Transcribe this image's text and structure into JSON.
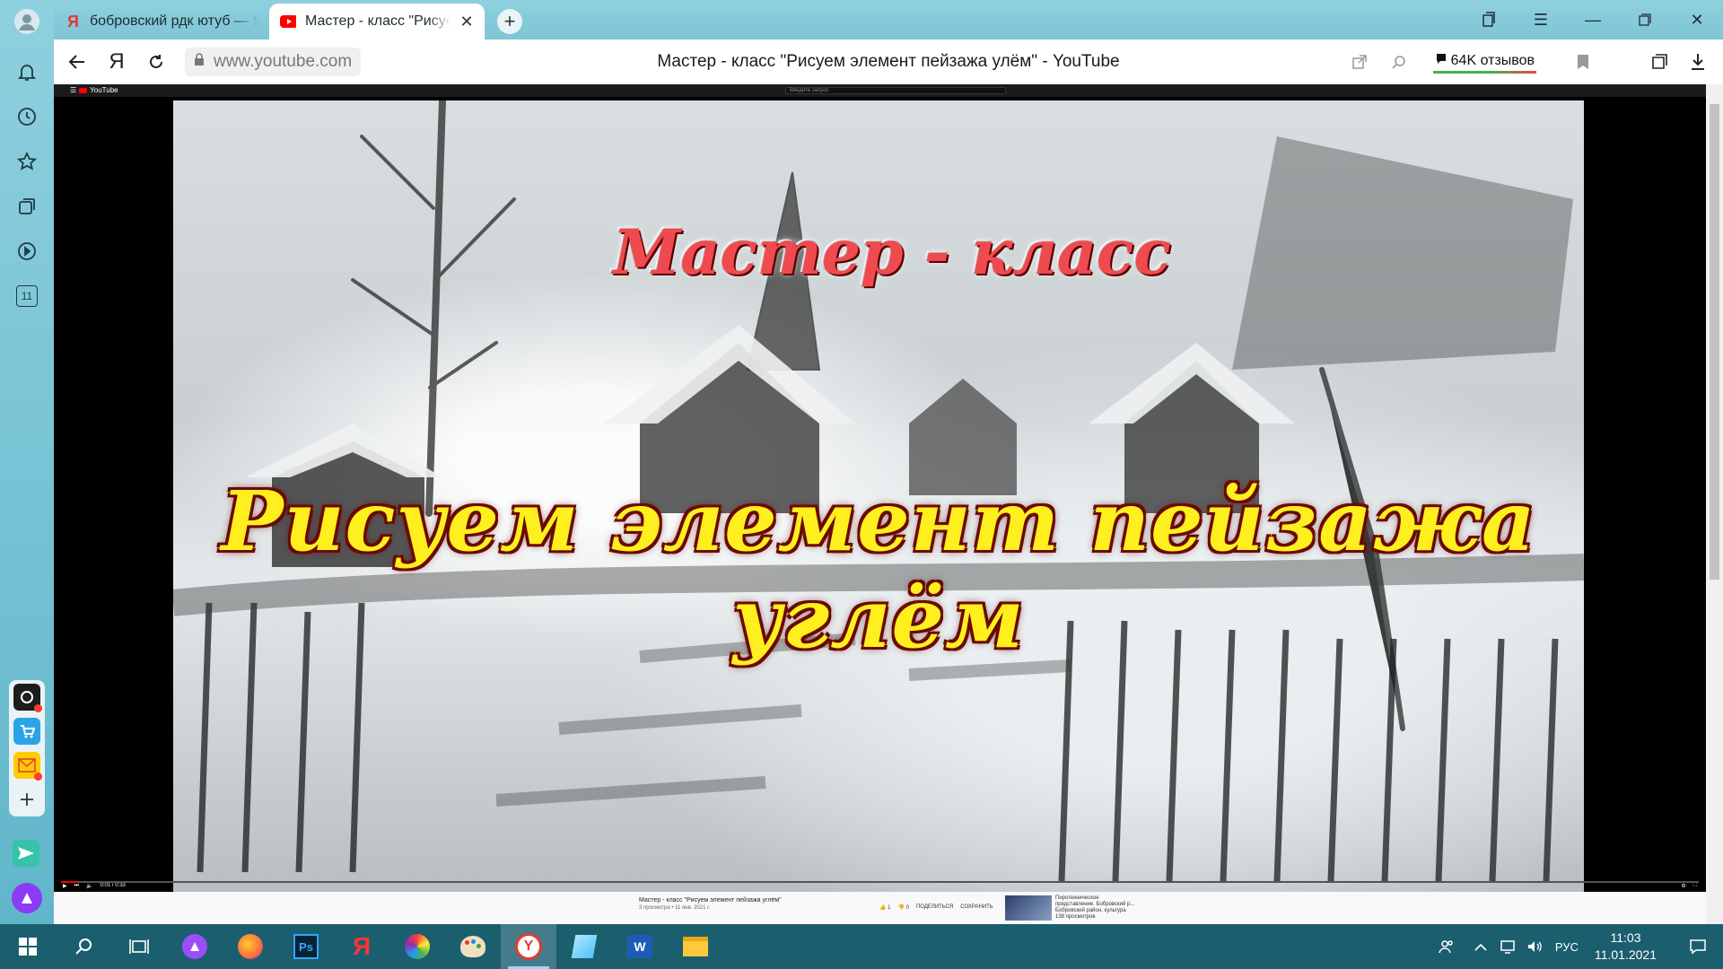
{
  "tabs": [
    {
      "title": "бобровский рдк ютуб — Я",
      "favicon": "yandex-icon"
    },
    {
      "title": "Мастер - класс \"Рисуем",
      "favicon": "youtube-icon",
      "active": true
    }
  ],
  "toolbar": {
    "yandex_button": "Я",
    "url": "www.youtube.com",
    "page_title": "Мастер - класс \"Рисуем элемент пейзажа улём\" - YouTube",
    "reviews": "64K отзывов"
  },
  "sidebar": {
    "tab_count": "11"
  },
  "youtube": {
    "logo": "YouTube",
    "search_placeholder": "Введите запрос",
    "video_title_line1": "Мастер - класс",
    "video_title_line2": "Рисуем элемент пейзажа углём",
    "progress": 0.01,
    "time": "0:01 / 0:33",
    "below_title": "Мастер - класс \"Рисуем элемент пейзажа углём\"",
    "below_meta": "3 просмотра • 11 янв. 2021 г.",
    "like_count": "1",
    "dislike_count": "0",
    "share_label": "ПОДЕЛИТЬСЯ",
    "save_label": "СОХРАНИТЬ",
    "related_title": "Пиротехническое представление. Бобровский р...",
    "related_channel": "Бобровский район, культура",
    "related_views": "138 просмотров"
  },
  "taskbar": {
    "lang": "РУС",
    "time": "11:03",
    "date": "11.01.2021"
  },
  "colors": {
    "taskbar": "#1b5f6e",
    "sidebar": "#7fc4d6",
    "title_red": "#ef4a4f",
    "title_yellow": "#ffef1f"
  }
}
